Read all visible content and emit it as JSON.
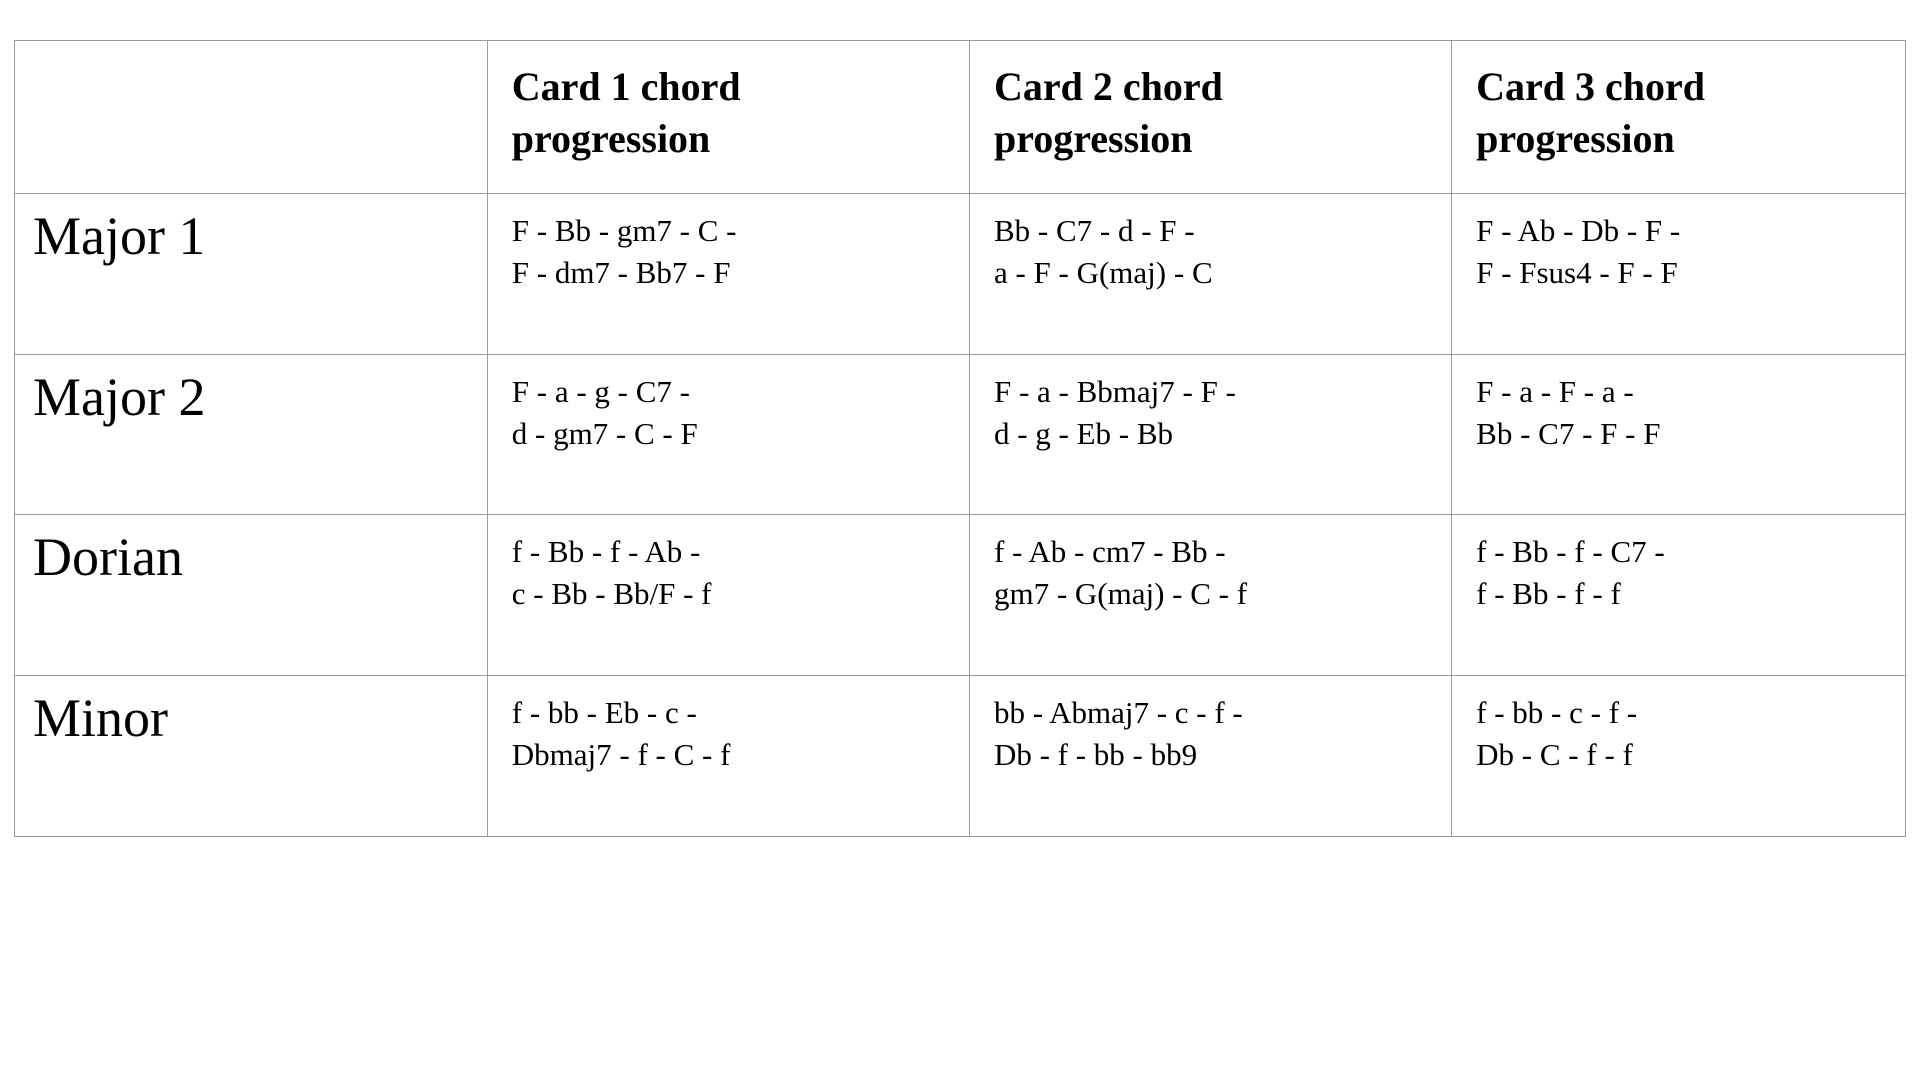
{
  "headers": {
    "blank": "",
    "card1": "Card 1 chord progression",
    "card2": "Card 2 chord progression",
    "card3": "Card 3 chord progression"
  },
  "rows": [
    {
      "label": "Major 1",
      "card1": "F - Bb -  gm7 -  C -\nF - dm7 - Bb7 - F",
      "card2": "Bb - C7 -  d -  F -\na - F - G(maj) - C",
      "card3": "F - Ab -  Db -  F -\nF - Fsus4 - F - F"
    },
    {
      "label": "Major 2",
      "card1": "F - a -  g -  C7 -\nd - gm7 - C - F",
      "card2": "F - a -  Bbmaj7 -  F -\nd - g - Eb - Bb",
      "card3": "F - a -  F -  a -\nBb - C7 - F - F"
    },
    {
      "label": "Dorian",
      "card1": "f - Bb -  f -  Ab -\nc - Bb - Bb/F - f",
      "card2": "f - Ab -  cm7 -  Bb -\ngm7 - G(maj) - C - f",
      "card3": "f - Bb -  f -  C7 -\nf - Bb - f - f"
    },
    {
      "label": "Minor",
      "card1": "f - bb -  Eb -  c -\nDbmaj7 - f - C - f",
      "card2": "bb - Abmaj7 -  c -  f -\nDb - f - bb - bb9",
      "card3": "f - bb -  c -  f -\nDb - C - f - f"
    }
  ]
}
